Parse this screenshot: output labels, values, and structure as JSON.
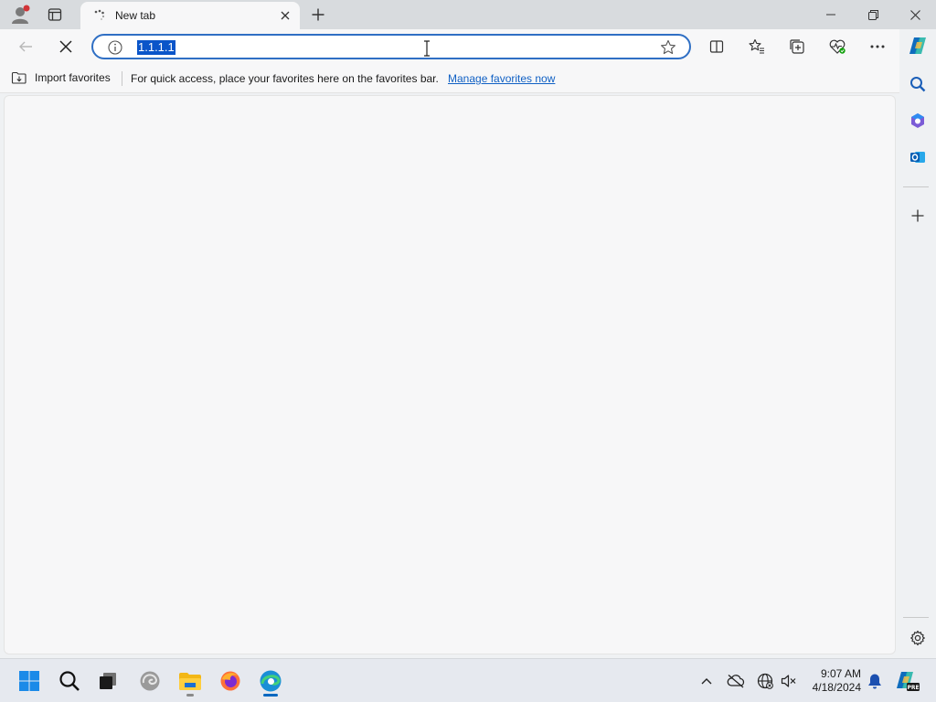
{
  "browser": {
    "tab": {
      "title": "New tab"
    },
    "address": {
      "url": "1.1.1.1"
    },
    "favorites_bar": {
      "import_label": "Import favorites",
      "message": "For quick access, place your favorites here on the favorites bar.",
      "manage_link": "Manage favorites now"
    }
  },
  "taskbar": {
    "time": "9:07 AM",
    "date": "4/18/2024"
  },
  "colors": {
    "accent": "#0a55c9",
    "link": "#1060c4",
    "address_border": "#2f6fc4"
  }
}
